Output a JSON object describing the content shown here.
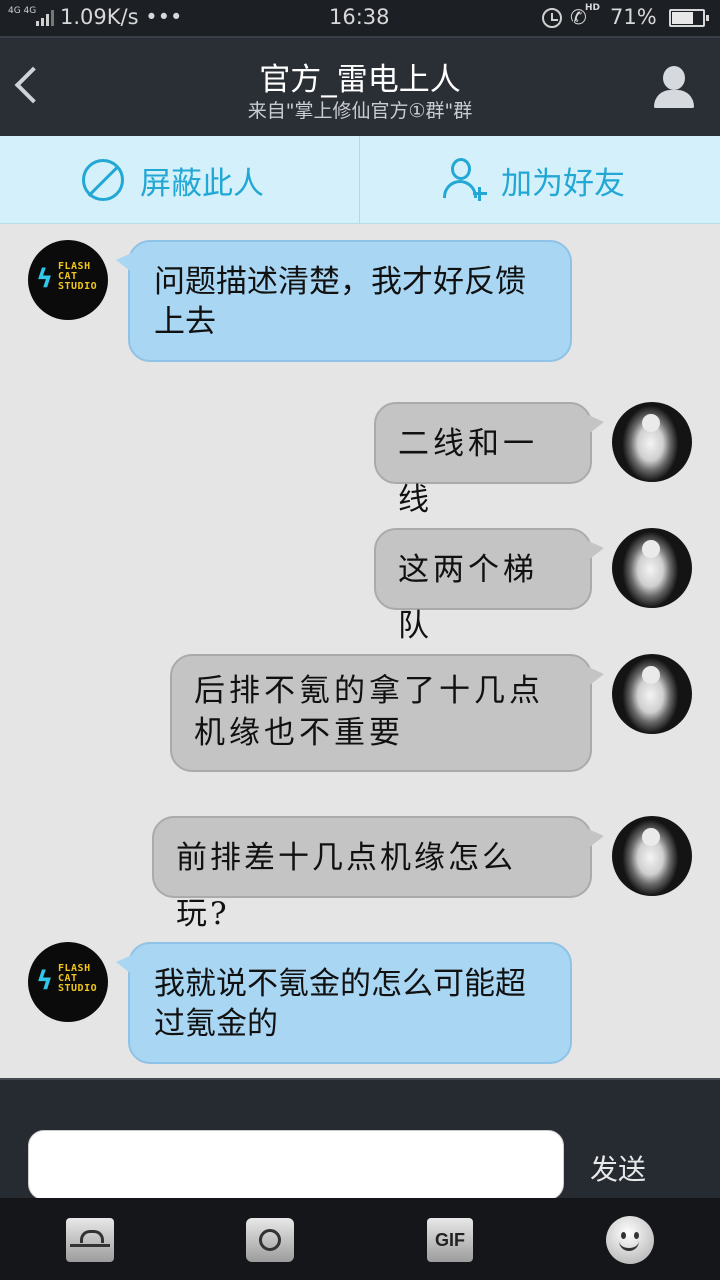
{
  "status_bar": {
    "network": "4G 4G",
    "speed": "1.09K/s •••",
    "time": "16:38",
    "hd": "HD",
    "battery": "71%",
    "battery_level": 0.71
  },
  "header": {
    "title": "官方_雷电上人",
    "subtitle": "来自\"掌上修仙官方①群\"群"
  },
  "actions": {
    "block_label": "屏蔽此人",
    "add_label": "加为好友"
  },
  "avatar_flash": {
    "line1": "FLASH",
    "line2": "CAT",
    "line3": "STUDIO"
  },
  "messages": [
    {
      "side": "in",
      "text": "问题描述清楚，我才好反馈上去"
    },
    {
      "side": "out",
      "text": "二线和一线"
    },
    {
      "side": "out",
      "text": "这两个梯队"
    },
    {
      "side": "out",
      "text": "后排不氪的拿了十几点机缘也不重要"
    },
    {
      "side": "out",
      "text": "前排差十几点机缘怎么玩?"
    },
    {
      "side": "in",
      "text": "我就说不氪金的怎么可能超过氪金的"
    }
  ],
  "input": {
    "value": "",
    "placeholder": "",
    "send_label": "发送"
  },
  "toolbar": {
    "gif_label": "GIF"
  }
}
